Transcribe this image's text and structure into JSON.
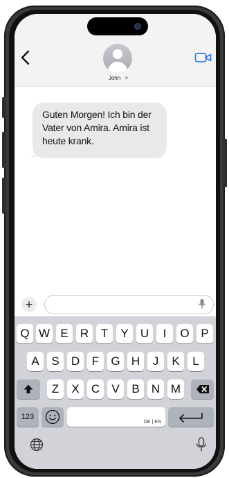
{
  "header": {
    "contact_name": "John",
    "contact_chevron": ">",
    "icons": {
      "back": "chevron-left-icon",
      "avatar": "contact-avatar-icon",
      "video": "video-call-icon"
    },
    "accent_color": "#2f7cf6"
  },
  "messages": [
    {
      "text": "Guten Morgen! Ich bin der Vater von Amira. Amira ist heute krank.",
      "direction": "incoming"
    }
  ],
  "composer": {
    "plus_label": "+",
    "input_value": "",
    "icons": {
      "mic": "microphone-icon"
    }
  },
  "keyboard": {
    "row1": [
      "Q",
      "W",
      "E",
      "R",
      "T",
      "Y",
      "U",
      "I",
      "O",
      "P"
    ],
    "row2": [
      "A",
      "S",
      "D",
      "F",
      "G",
      "H",
      "J",
      "K",
      "L"
    ],
    "row3": [
      "Z",
      "X",
      "C",
      "V",
      "B",
      "N",
      "M"
    ],
    "numbers_label": "123",
    "space_language_label": "DE | EN",
    "icons": {
      "shift": "shift-arrow-icon",
      "backspace": "backspace-icon",
      "emoji": "emoji-icon",
      "return": "return-icon",
      "globe": "globe-icon",
      "dictation": "microphone-icon"
    }
  }
}
